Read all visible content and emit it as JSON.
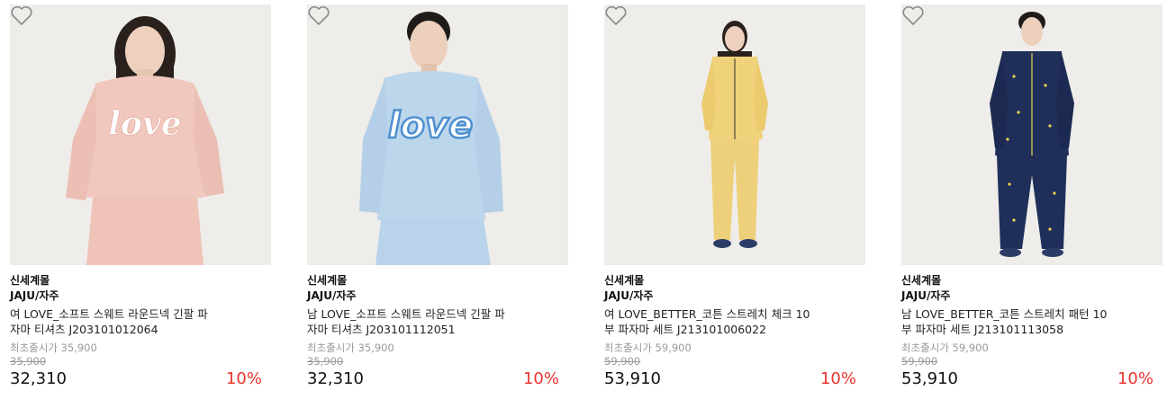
{
  "products": [
    {
      "mall": "신세계몰",
      "brand": "JAJU/자주",
      "name_line1": "여 LOVE_소프트 스웨트 라운드넥 긴팔 파",
      "name_line2": "자마 티셔츠 J203101012064",
      "first_price_label": "최초출시가 35,900",
      "original_price": "35,900",
      "sale_price": "32,310",
      "discount": "10%",
      "garment_color": "#f1c8be",
      "print_color": "#ffffff",
      "graphic_text": "love"
    },
    {
      "mall": "신세계몰",
      "brand": "JAJU/자주",
      "name_line1": "남 LOVE_소프트 스웨트 라운드넥 긴팔 파",
      "name_line2": "자마 티셔츠 J203101112051",
      "first_price_label": "최초출시가 35,900",
      "original_price": "35,900",
      "sale_price": "32,310",
      "discount": "10%",
      "garment_color": "#bcd6ec",
      "print_color": "#4f8fd0",
      "graphic_text": "love"
    },
    {
      "mall": "신세계몰",
      "brand": "JAJU/자주",
      "name_line1": "여 LOVE_BETTER_코튼 스트레치 체크 10",
      "name_line2": "부 파자마 세트 J213101006022",
      "first_price_label": "최초출시가 59,900",
      "original_price": "59,900",
      "sale_price": "53,910",
      "discount": "10%",
      "garment_color": "#f0d27a",
      "print_color": "#ffffff",
      "graphic_text": ""
    },
    {
      "mall": "신세계몰",
      "brand": "JAJU/자주",
      "name_line1": "남 LOVE_BETTER_코튼 스트레치 패턴 10",
      "name_line2": "부 파자마 세트 J213101113058",
      "first_price_label": "최초출시가 59,900",
      "original_price": "59,900",
      "sale_price": "53,910",
      "discount": "10%",
      "garment_color": "#1f2f5a",
      "print_color": "#f2d54a",
      "graphic_text": ""
    }
  ],
  "icons": {
    "wishlist": "heart-outline-icon"
  },
  "colors": {
    "discount": "#e8352d",
    "muted": "#999999",
    "background": "#eeedea"
  }
}
